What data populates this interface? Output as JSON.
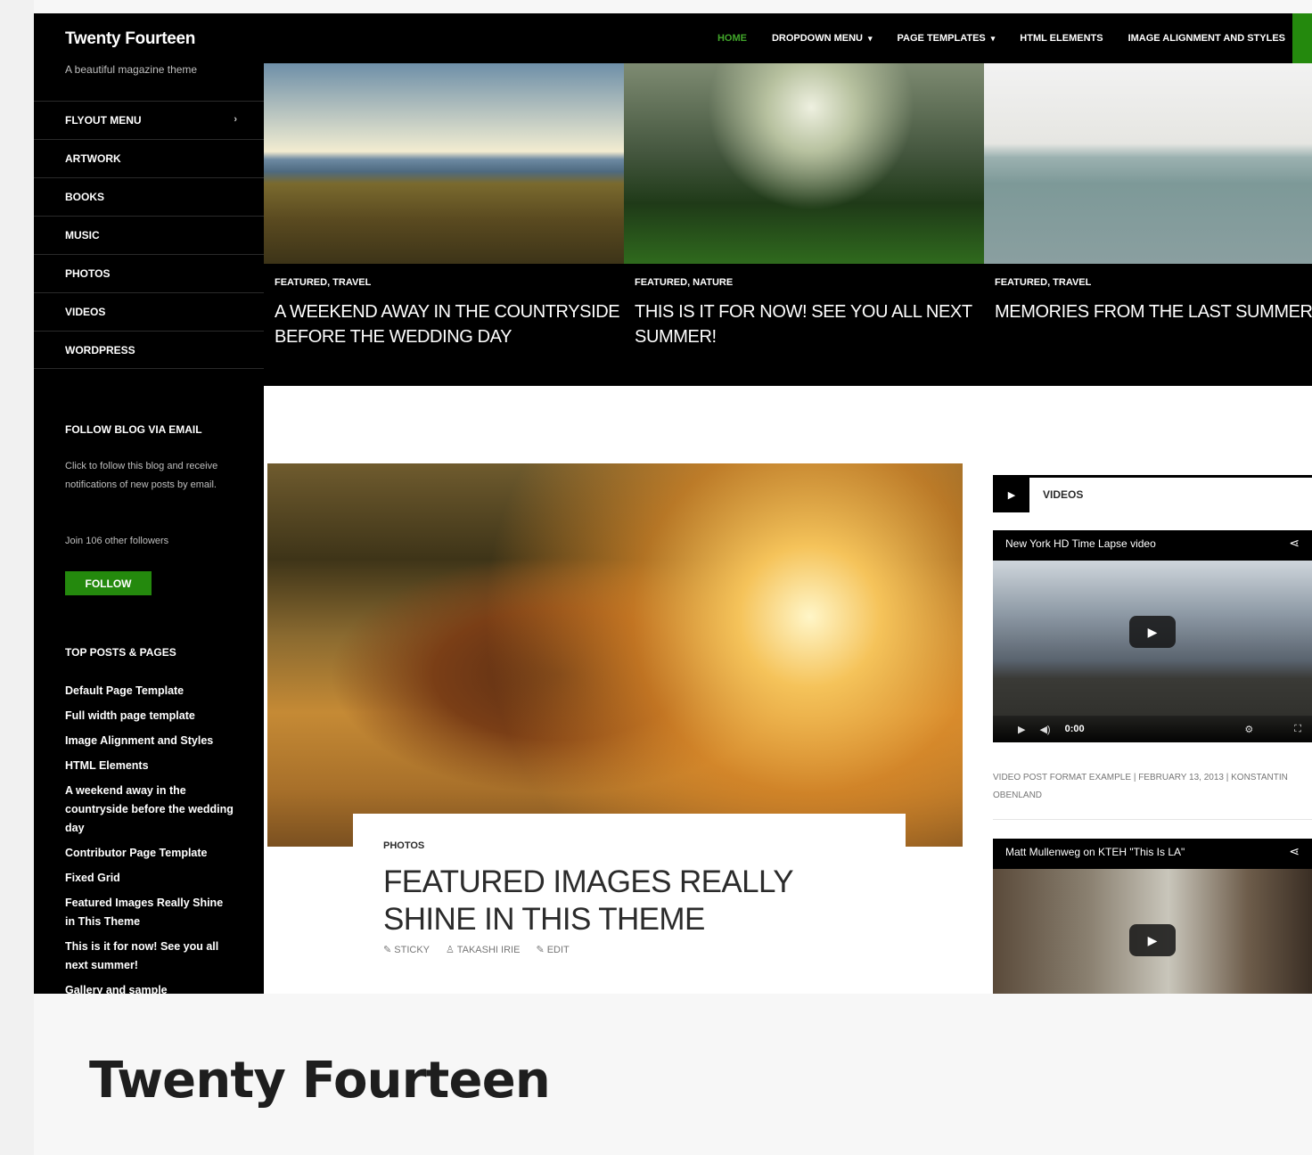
{
  "site": {
    "title": "Twenty Fourteen",
    "description": "A beautiful magazine theme"
  },
  "top_nav": [
    {
      "label": "Home",
      "active": true,
      "has_dropdown": false
    },
    {
      "label": "Dropdown Menu",
      "active": false,
      "has_dropdown": true
    },
    {
      "label": "Page Templates",
      "active": false,
      "has_dropdown": true
    },
    {
      "label": "HTML Elements",
      "active": false,
      "has_dropdown": false
    },
    {
      "label": "Image Alignment and Styles",
      "active": false,
      "has_dropdown": false
    }
  ],
  "side_nav": [
    {
      "label": "Flyout Menu",
      "arrow": "›"
    },
    {
      "label": "Artwork"
    },
    {
      "label": "Books"
    },
    {
      "label": "Music"
    },
    {
      "label": "Photos"
    },
    {
      "label": "Videos"
    },
    {
      "label": "WordPress"
    }
  ],
  "follow_widget": {
    "title": "Follow Blog via Email",
    "text": "Click to follow this blog and receive notifications of new posts by email.",
    "followers": "Join 106 other followers",
    "button": "Follow"
  },
  "top_posts": {
    "title": "Top Posts & Pages",
    "items": [
      "Default Page Template",
      "Full width page template",
      "Image Alignment and Styles",
      "HTML Elements",
      "A weekend away in the countryside before the wedding day",
      "Contributor Page Template",
      "Fixed Grid",
      "Featured Images Really Shine in This Theme",
      "This is it for now! See you all next summer!",
      "Gallery and sample"
    ]
  },
  "featured": [
    {
      "categories": "Featured, Travel",
      "title": "A weekend away in the countryside before the wedding day"
    },
    {
      "categories": "Featured, Nature",
      "title": "This is it for now! See you all next summer!"
    },
    {
      "categories": "Featured, Travel",
      "title": "Memories from the last summer"
    }
  ],
  "main_post": {
    "category": "Photos",
    "title": "Featured Images Really Shine in This Theme",
    "meta": [
      "Sticky",
      "Takashi Irie",
      "Edit"
    ]
  },
  "videos_widget": {
    "title": "Videos",
    "video1": {
      "title": "New York HD Time Lapse video",
      "time": "0:00"
    },
    "video1_meta": "Video post format example | February 13, 2013 | Konstantin Obenland",
    "video2": {
      "title": "Matt Mullenweg on KTEH \"This Is LA\""
    }
  },
  "product_title": "Twenty Fourteen",
  "colors": {
    "accent": "#24890d",
    "active_nav": "#41a62a",
    "header_bg": "#000000"
  }
}
